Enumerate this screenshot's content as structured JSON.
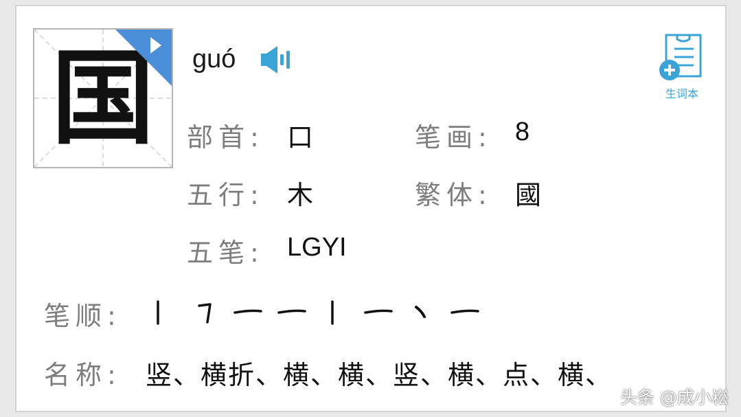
{
  "character": "国",
  "pinyin": "guó",
  "vocab_button": {
    "label": "生词本"
  },
  "info": {
    "radical": {
      "label": "部首:",
      "value": "口"
    },
    "strokes_count": {
      "label": "笔画:",
      "value": "8"
    },
    "wuxing": {
      "label": "五行:",
      "value": "木"
    },
    "traditional": {
      "label": "繁体:",
      "value": "國"
    },
    "wubi": {
      "label": "五笔:",
      "value": "LGYI"
    }
  },
  "stroke_order": {
    "label": "笔顺:",
    "strokes": [
      "丨",
      "㇕",
      "一",
      "一",
      "丨",
      "一",
      "丶",
      "一"
    ]
  },
  "stroke_names": {
    "label": "名称:",
    "text": "竖、横折、横、横、竖、横、点、横、"
  },
  "watermark": "头条 @成小崧",
  "colors": {
    "accent_blue": "#3aa3d8",
    "corner_blue": "#4a8fd8",
    "label_gray": "#7d7d7d",
    "text_dark": "#111111"
  },
  "icons": {
    "play": "play-triangle-icon",
    "speaker": "speaker-icon",
    "vocab": "notebook-add-icon"
  }
}
